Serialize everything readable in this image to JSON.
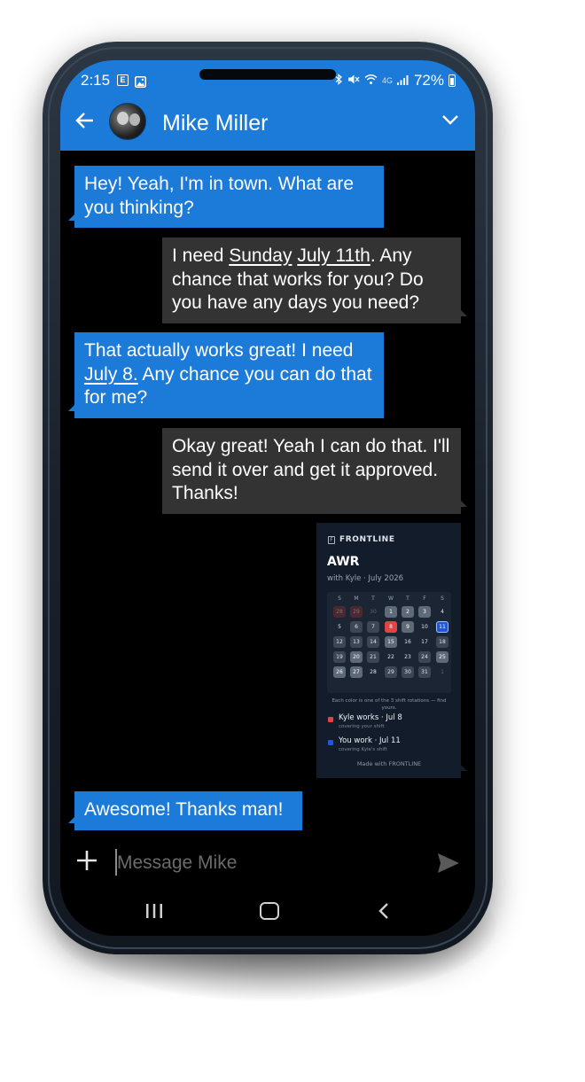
{
  "status_bar": {
    "time": "2:15",
    "notif_icon_1": "E",
    "notif_icon_2": "image-icon",
    "network": "4G",
    "battery": "72%"
  },
  "header": {
    "contact_name": "Mike Miller",
    "back_icon": "back-arrow-icon",
    "expand_icon": "chevron-down-icon",
    "accent_color": "#1c7ad8"
  },
  "messages": {
    "m1": {
      "direction": "incoming",
      "text": "Hey! Yeah, I'm in town. What are you thinking?"
    },
    "m2": {
      "direction": "outgoing",
      "before": "I need ",
      "link1": "Sunday",
      "link2": "July 11th",
      "after": ". Any chance that works for you? Do you have any days you need?"
    },
    "m3": {
      "direction": "incoming",
      "link": "July 8.",
      "after": " Any chance you can do that for me?",
      "before": "That actually works great! I need"
    },
    "m4": {
      "direction": "outgoing",
      "text": "Okay great! Yeah I can do that. I'll send it over and get it approved. Thanks!"
    },
    "m6": {
      "direction": "incoming",
      "text": "Awesome! Thanks man!"
    }
  },
  "calendar_card": {
    "brand": "FRONTLINE",
    "brand_icon": "F",
    "title": "AWR",
    "subtitle": "with Kyle · July 2026",
    "weekdays": [
      "S",
      "M",
      "T",
      "W",
      "T",
      "F",
      "S"
    ],
    "note": "Each color is one of the 3 shift rotations — find yours.",
    "legend": [
      {
        "label": "Kyle works · Jul 8",
        "sub": "covering your shift",
        "color": "#e04444"
      },
      {
        "label": "You work · Jul 11",
        "sub": "covering Kyle's shift",
        "color": "#2156d8"
      }
    ],
    "footer": "Made with FRONTLINE"
  },
  "composer": {
    "placeholder": "Message Mike",
    "plus_icon": "plus-icon",
    "send_icon": "send-icon"
  },
  "nav": {
    "recents": "recents-icon",
    "home": "home-icon",
    "back": "back-chevron-icon"
  }
}
